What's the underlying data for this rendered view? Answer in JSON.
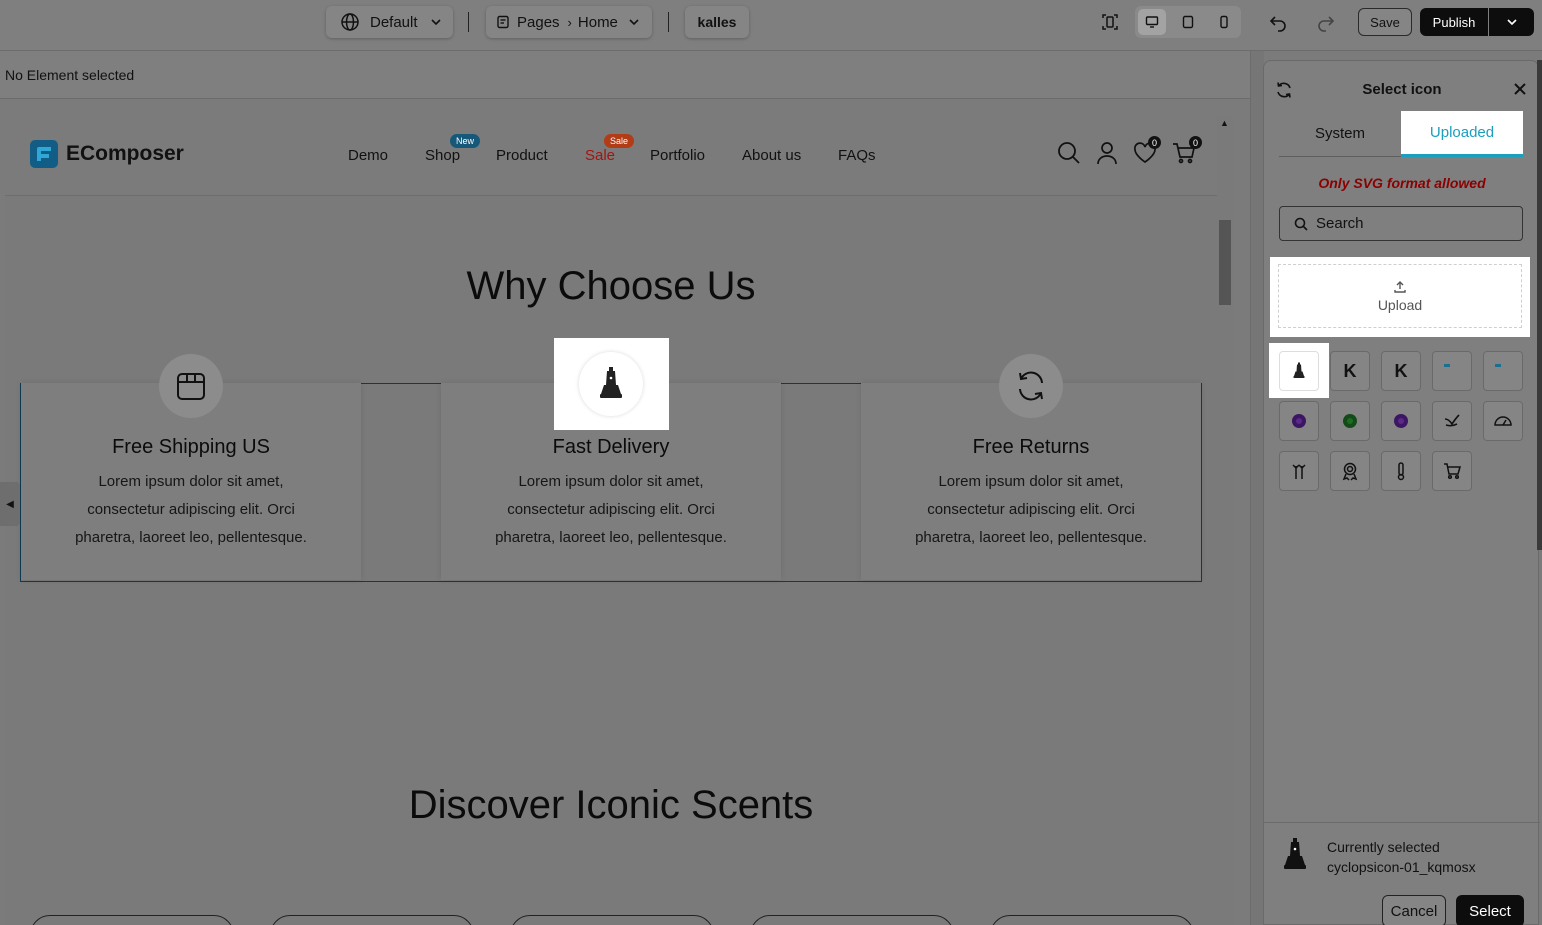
{
  "toolbar": {
    "language": "Default",
    "pages_label": "Pages",
    "page_name": "Home",
    "theme": "kalles",
    "save": "Save",
    "publish": "Publish"
  },
  "status": {
    "selection": "No Element selected"
  },
  "site": {
    "logo_text": "EComposer",
    "nav": [
      {
        "label": "Demo"
      },
      {
        "label": "Shop",
        "badge": "New"
      },
      {
        "label": "Product"
      },
      {
        "label": "Sale",
        "badge": "Sale"
      },
      {
        "label": "Portfolio"
      },
      {
        "label": "About us"
      },
      {
        "label": "FAQs"
      }
    ],
    "wishlist_count": "0",
    "cart_count": "0",
    "section1_title": "Why Choose Us",
    "features": [
      {
        "title": "Free Shipping US",
        "text": "Lorem ipsum dolor sit amet, consectetur adipiscing elit. Orci pharetra, laoreet leo, pellentesque."
      },
      {
        "title": "Fast Delivery",
        "text": "Lorem ipsum dolor sit amet, consectetur adipiscing elit. Orci pharetra, laoreet leo, pellentesque."
      },
      {
        "title": "Free Returns",
        "text": "Lorem ipsum dolor sit amet, consectetur adipiscing elit. Orci pharetra, laoreet leo, pellentesque."
      }
    ],
    "section2_title": "Discover Iconic Scents"
  },
  "picker": {
    "title": "Select icon",
    "tabs": [
      "System",
      "Uploaded"
    ],
    "active_tab": "Uploaded",
    "notice": "Only SVG format allowed",
    "search_placeholder": "Search",
    "upload_label": "Upload",
    "icons": [
      "cyclops-pawn",
      "k-letter",
      "k-letter",
      "flag-mark",
      "flag-mark",
      "purple-blob",
      "green-blob",
      "purple-blob",
      "hand-scribble",
      "dashboard",
      "plant-pot",
      "ribbon-award",
      "thermometer",
      "shopping-cart"
    ],
    "current_label": "Currently selected",
    "current_icon": "cyclopsicon-01_kqmosx",
    "cancel": "Cancel",
    "select": "Select"
  },
  "colors": {
    "accent": "#1a9fbf",
    "sale_red": "#a3150f",
    "new_badge": "#16587a",
    "sale_badge": "#b23c16",
    "dark": "#0d0d0d"
  }
}
